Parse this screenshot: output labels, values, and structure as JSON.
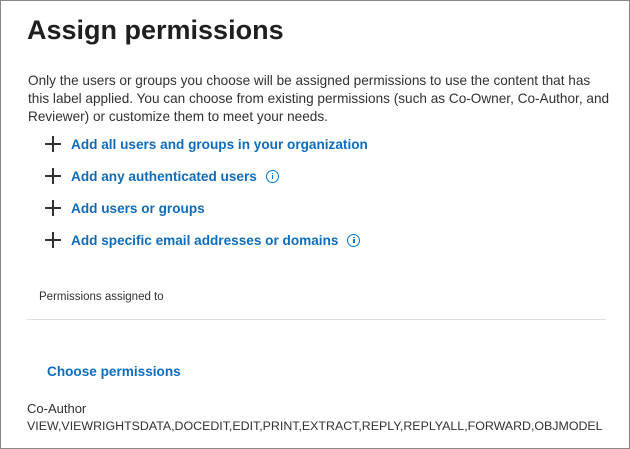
{
  "panel": {
    "title": "Assign permissions",
    "description": "Only the users or groups you choose will be assigned permissions to use the content that has this label applied. You can choose from existing permissions (such as Co-Owner, Co-Author, and Reviewer) or customize them to meet your needs."
  },
  "actions": [
    {
      "label": "Add all users and groups in your organization",
      "icon": "plus-icon",
      "info": false
    },
    {
      "label": "Add any authenticated users",
      "icon": "plus-icon",
      "info": true
    },
    {
      "label": "Add users or groups",
      "icon": "plus-icon",
      "info": false
    },
    {
      "label": "Add specific email addresses or domains",
      "icon": "plus-icon",
      "info": true
    }
  ],
  "permissions": {
    "header": "Permissions assigned to",
    "choose_label": "Choose permissions",
    "role": "Co-Author",
    "rights": "VIEW,VIEWRIGHTSDATA,DOCEDIT,EDIT,PRINT,EXTRACT,REPLY,REPLYALL,FORWARD,OBJMODEL"
  },
  "colors": {
    "link": "#0f6cbd",
    "text": "#323130",
    "border": "#8a8886",
    "info_icon": "#0078d4"
  }
}
